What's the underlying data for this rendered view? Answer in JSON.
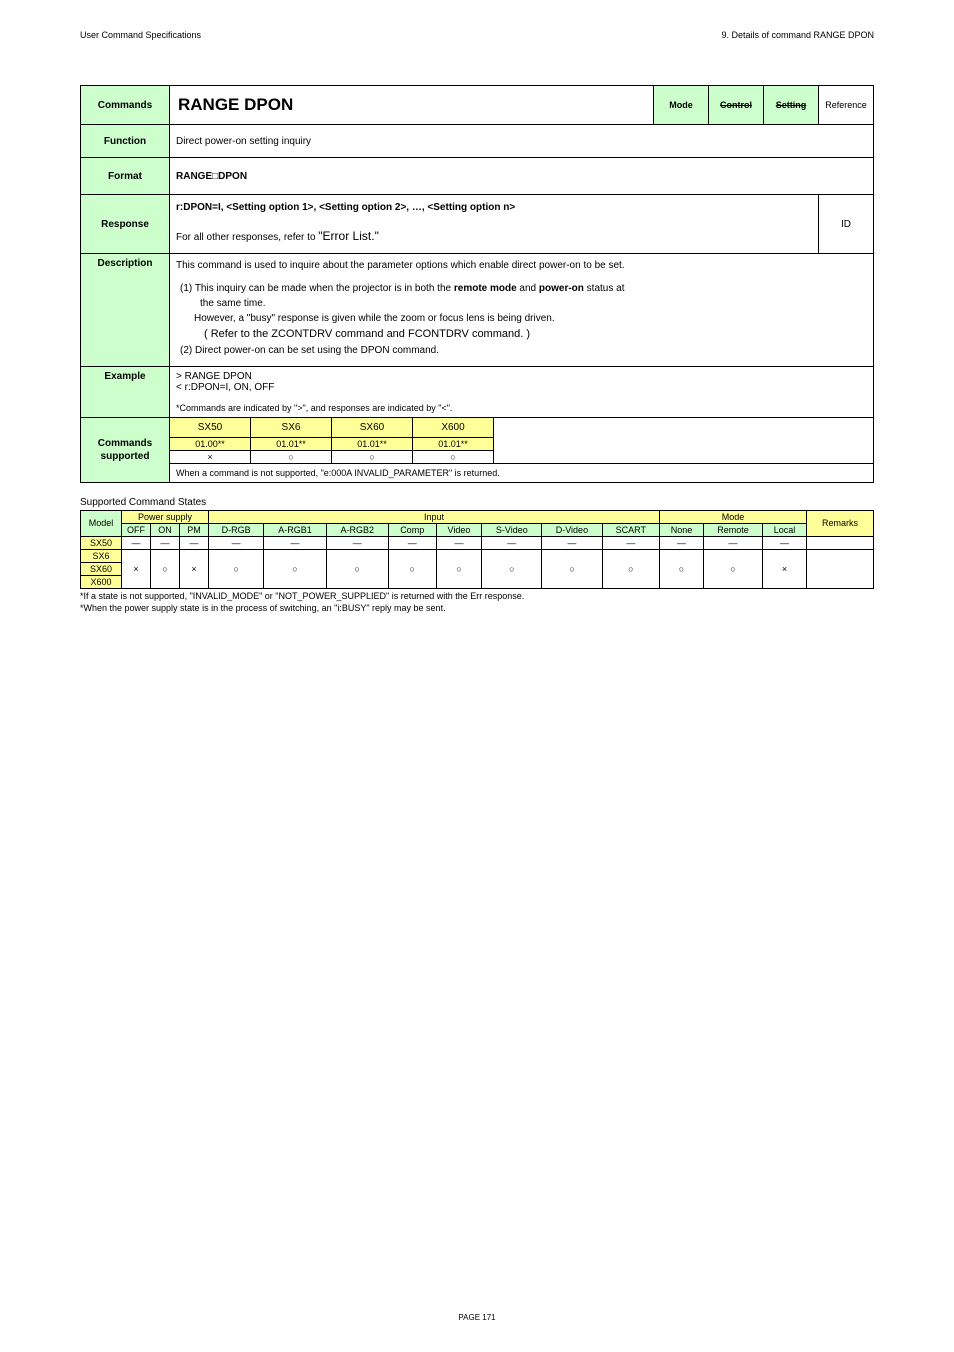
{
  "header": {
    "left": "User Command Specifications",
    "right": "9. Details of command  RANGE DPON"
  },
  "labels": {
    "commands": "Commands",
    "function": "Function",
    "format": "Format",
    "response": "Response",
    "description": "Description",
    "example": "Example",
    "cmds_supported_l1": "Commands",
    "cmds_supported_l2": "supported",
    "mode": "Mode",
    "control": "Control",
    "setting": "Setting",
    "reference": "Reference",
    "id": "ID"
  },
  "cmd_title": "RANGE DPON",
  "function_text": "Direct power-on setting inquiry",
  "format_text": "RANGE□DPON",
  "response": {
    "line1": "r:DPON=I, <Setting option 1>, <Setting option 2>, …, <Setting option n>",
    "line2a": "For all other responses, refer to ",
    "line2b": "\"Error List.\""
  },
  "description": {
    "intro": "This command is used to inquire about the parameter options which enable direct power-on to be set.",
    "p1a": "(1) This inquiry can be made when the projector is in both the ",
    "p1b": "remote mode",
    "p1c": " and ",
    "p1d": "power-on",
    "p1e": " status at",
    "p1f": "the same time.",
    "p2": "However, a \"busy\" response is given while the zoom or focus lens is being driven.",
    "p3": "( Refer to the ZCONTDRV command and FCONTDRV command.  )",
    "p4": "(2) Direct power-on can be set using the DPON command."
  },
  "example": {
    "l1": "> RANGE DPON",
    "l2": "< r:DPON=I, ON, OFF",
    "note": "*Commands are indicated by \">\", and responses are indicated by \"<\"."
  },
  "cmds_supported": {
    "h": [
      "SX50",
      "SX6",
      "SX60",
      "X600"
    ],
    "r1": [
      "01.00**",
      "01.01**",
      "01.01**",
      "01.01**"
    ],
    "r2": [
      "×",
      "○",
      "○",
      "○"
    ],
    "footer": "When a command is not supported, \"e:000A INVALID_PARAMETER\" is returned."
  },
  "states_title": "Supported Command States",
  "states": {
    "hdr": {
      "model": "Model",
      "power": "Power supply",
      "input": "Input",
      "mode": "Mode",
      "remarks": "Remarks",
      "off": "OFF",
      "on": "ON",
      "pm": "PM",
      "drgb": "D-RGB",
      "argb1": "A-RGB1",
      "argb2": "A-RGB2",
      "comp": "Comp",
      "video": "Video",
      "svideo": "S-Video",
      "dvideo": "D-Video",
      "scart": "SCART",
      "none": "None",
      "remote": "Remote",
      "local": "Local"
    },
    "rows": [
      {
        "model": "SX50",
        "cells": [
          "―",
          "―",
          "―",
          "―",
          "―",
          "―",
          "―",
          "―",
          "―",
          "―",
          "―",
          "―",
          "―",
          "―"
        ],
        "rem": ""
      },
      {
        "model": "SX6",
        "cells": [
          "×",
          "○",
          "×",
          "○",
          "○",
          "○",
          "○",
          "○",
          "○",
          "○",
          "○",
          "○",
          "○",
          "×"
        ],
        "rem": ""
      },
      {
        "model": "SX60",
        "cells": [
          "",
          "",
          "",
          "",
          "",
          "",
          "",
          "",
          "",
          "",
          "",
          "",
          "",
          ""
        ],
        "rem": ""
      },
      {
        "model": "X600",
        "cells": [
          "",
          "",
          "",
          "",
          "",
          "",
          "",
          "",
          "",
          "",
          "",
          "",
          "",
          ""
        ],
        "rem": ""
      }
    ]
  },
  "footnotes": {
    "f1": "*If a state is not supported, \"INVALID_MODE\" or \"NOT_POWER_SUPPLIED\" is returned with the Err response.",
    "f2": "*When the power supply state is in the process of switching, an \"i:BUSY\" reply may be sent."
  },
  "page": "PAGE 171"
}
